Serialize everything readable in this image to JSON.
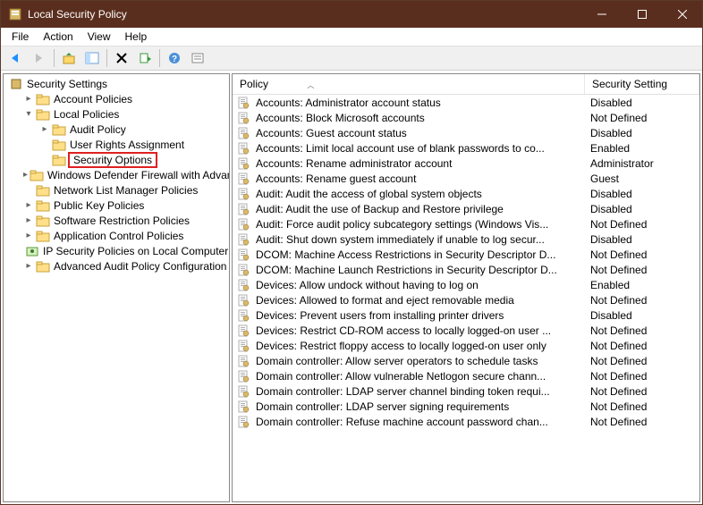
{
  "window": {
    "title": "Local Security Policy"
  },
  "menu": [
    "File",
    "Action",
    "View",
    "Help"
  ],
  "headers": {
    "policy": "Policy",
    "setting": "Security Setting"
  },
  "tree": {
    "root": "Security Settings",
    "items": [
      {
        "label": "Account Policies",
        "indent": 1,
        "toggle": ">",
        "icon": "folder"
      },
      {
        "label": "Local Policies",
        "indent": 1,
        "toggle": "v",
        "icon": "folder"
      },
      {
        "label": "Audit Policy",
        "indent": 2,
        "toggle": ">",
        "icon": "folder"
      },
      {
        "label": "User Rights Assignment",
        "indent": 2,
        "toggle": "",
        "icon": "folder"
      },
      {
        "label": "Security Options",
        "indent": 2,
        "toggle": "",
        "icon": "folder",
        "selected": true
      },
      {
        "label": "Windows Defender Firewall with Advanced Security",
        "indent": 1,
        "toggle": ">",
        "icon": "folder"
      },
      {
        "label": "Network List Manager Policies",
        "indent": 1,
        "toggle": "",
        "icon": "folder"
      },
      {
        "label": "Public Key Policies",
        "indent": 1,
        "toggle": ">",
        "icon": "folder"
      },
      {
        "label": "Software Restriction Policies",
        "indent": 1,
        "toggle": ">",
        "icon": "folder"
      },
      {
        "label": "Application Control Policies",
        "indent": 1,
        "toggle": ">",
        "icon": "folder"
      },
      {
        "label": "IP Security Policies on Local Computer",
        "indent": 1,
        "toggle": "",
        "icon": "ip"
      },
      {
        "label": "Advanced Audit Policy Configuration",
        "indent": 1,
        "toggle": ">",
        "icon": "folder"
      }
    ]
  },
  "policies": [
    {
      "name": "Accounts: Administrator account status",
      "setting": "Disabled"
    },
    {
      "name": "Accounts: Block Microsoft accounts",
      "setting": "Not Defined"
    },
    {
      "name": "Accounts: Guest account status",
      "setting": "Disabled"
    },
    {
      "name": "Accounts: Limit local account use of blank passwords to co...",
      "setting": "Enabled"
    },
    {
      "name": "Accounts: Rename administrator account",
      "setting": "Administrator"
    },
    {
      "name": "Accounts: Rename guest account",
      "setting": "Guest"
    },
    {
      "name": "Audit: Audit the access of global system objects",
      "setting": "Disabled"
    },
    {
      "name": "Audit: Audit the use of Backup and Restore privilege",
      "setting": "Disabled"
    },
    {
      "name": "Audit: Force audit policy subcategory settings (Windows Vis...",
      "setting": "Not Defined"
    },
    {
      "name": "Audit: Shut down system immediately if unable to log secur...",
      "setting": "Disabled"
    },
    {
      "name": "DCOM: Machine Access Restrictions in Security Descriptor D...",
      "setting": "Not Defined"
    },
    {
      "name": "DCOM: Machine Launch Restrictions in Security Descriptor D...",
      "setting": "Not Defined"
    },
    {
      "name": "Devices: Allow undock without having to log on",
      "setting": "Enabled"
    },
    {
      "name": "Devices: Allowed to format and eject removable media",
      "setting": "Not Defined"
    },
    {
      "name": "Devices: Prevent users from installing printer drivers",
      "setting": "Disabled"
    },
    {
      "name": "Devices: Restrict CD-ROM access to locally logged-on user ...",
      "setting": "Not Defined"
    },
    {
      "name": "Devices: Restrict floppy access to locally logged-on user only",
      "setting": "Not Defined"
    },
    {
      "name": "Domain controller: Allow server operators to schedule tasks",
      "setting": "Not Defined"
    },
    {
      "name": "Domain controller: Allow vulnerable Netlogon secure chann...",
      "setting": "Not Defined"
    },
    {
      "name": "Domain controller: LDAP server channel binding token requi...",
      "setting": "Not Defined"
    },
    {
      "name": "Domain controller: LDAP server signing requirements",
      "setting": "Not Defined"
    },
    {
      "name": "Domain controller: Refuse machine account password chan...",
      "setting": "Not Defined"
    }
  ]
}
